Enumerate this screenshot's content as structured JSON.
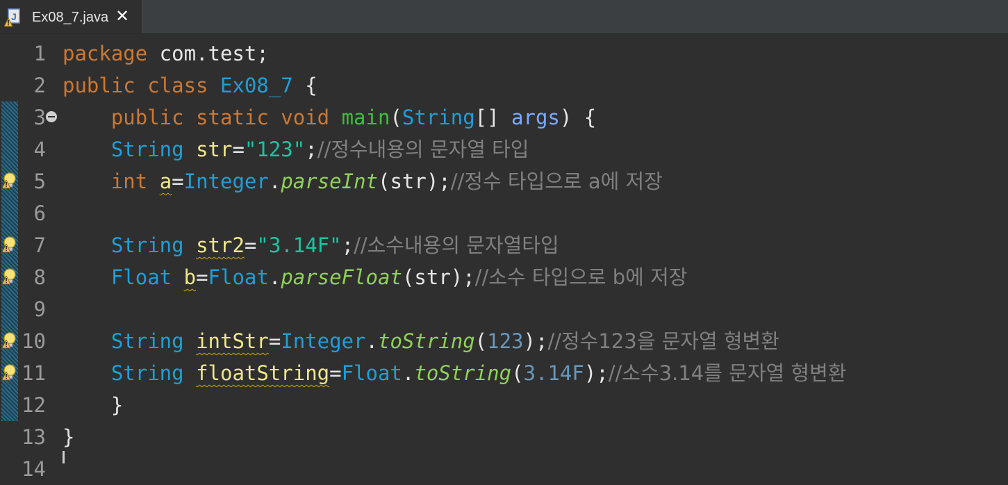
{
  "tab": {
    "title": "Ex08_7.java",
    "close_glyph": "✕",
    "icon": "java-file-warning-icon"
  },
  "lines": [
    {
      "num": "1",
      "parts": [
        [
          "package",
          "kw"
        ],
        [
          " com.test;",
          "plain"
        ]
      ]
    },
    {
      "num": "2",
      "parts": [
        [
          "public class ",
          "kw"
        ],
        [
          "Ex08_7",
          "ty"
        ],
        [
          " {",
          "plain"
        ]
      ]
    },
    {
      "num": "3",
      "fold": true,
      "marker": true,
      "parts": [
        [
          "    public static void ",
          "kw"
        ],
        [
          "main",
          "fn"
        ],
        [
          "(",
          "plain"
        ],
        [
          "String",
          "ty"
        ],
        [
          "[] ",
          "plain"
        ],
        [
          "args",
          "prm"
        ],
        [
          ") {",
          "plain"
        ]
      ]
    },
    {
      "num": "4",
      "marker": true,
      "parts": [
        [
          "    ",
          "plain"
        ],
        [
          "String ",
          "ty"
        ],
        [
          "str",
          "vnorm"
        ],
        [
          "=",
          "plain"
        ],
        [
          "\"123\"",
          "st"
        ],
        [
          ";",
          "plain"
        ],
        [
          "//정수내용의 문자열 타입",
          "cm"
        ]
      ]
    },
    {
      "num": "5",
      "marker": true,
      "warn": true,
      "parts": [
        [
          "    ",
          "plain"
        ],
        [
          "int ",
          "kw"
        ],
        [
          "a",
          "var"
        ],
        [
          "=",
          "plain"
        ],
        [
          "Integer",
          "ty"
        ],
        [
          ".",
          "plain"
        ],
        [
          "parseInt",
          "it"
        ],
        [
          "(str);",
          "plain"
        ],
        [
          "//정수 타입으로 a에 저장",
          "cm"
        ]
      ]
    },
    {
      "num": "6",
      "marker": true,
      "parts": []
    },
    {
      "num": "7",
      "marker": true,
      "warn": true,
      "parts": [
        [
          "    ",
          "plain"
        ],
        [
          "String ",
          "ty"
        ],
        [
          "str2",
          "var"
        ],
        [
          "=",
          "plain"
        ],
        [
          "\"3.14F\"",
          "st"
        ],
        [
          ";",
          "plain"
        ],
        [
          "//소수내용의 문자열타입",
          "cm"
        ]
      ]
    },
    {
      "num": "8",
      "marker": true,
      "warn": true,
      "parts": [
        [
          "    ",
          "plain"
        ],
        [
          "Float ",
          "ty"
        ],
        [
          "b",
          "var"
        ],
        [
          "=",
          "plain"
        ],
        [
          "Float",
          "ty"
        ],
        [
          ".",
          "plain"
        ],
        [
          "parseFloat",
          "it"
        ],
        [
          "(str);",
          "plain"
        ],
        [
          "//소수 타입으로 b에 저장",
          "cm"
        ]
      ]
    },
    {
      "num": "9",
      "marker": true,
      "parts": []
    },
    {
      "num": "10",
      "marker": true,
      "warn": true,
      "parts": [
        [
          "    ",
          "plain"
        ],
        [
          "String ",
          "ty"
        ],
        [
          "intStr",
          "var"
        ],
        [
          "=",
          "plain"
        ],
        [
          "Integer",
          "ty"
        ],
        [
          ".",
          "plain"
        ],
        [
          "toString",
          "it"
        ],
        [
          "(",
          "plain"
        ],
        [
          "123",
          "num"
        ],
        [
          ");",
          "plain"
        ],
        [
          "//정수123을 문자열 형변환",
          "cm"
        ]
      ]
    },
    {
      "num": "11",
      "marker": true,
      "warn": true,
      "parts": [
        [
          "    ",
          "plain"
        ],
        [
          "String ",
          "ty"
        ],
        [
          "floatString",
          "var"
        ],
        [
          "=",
          "plain"
        ],
        [
          "Float",
          "ty"
        ],
        [
          ".",
          "plain"
        ],
        [
          "toString",
          "it"
        ],
        [
          "(",
          "plain"
        ],
        [
          "3.14F",
          "num"
        ],
        [
          ");",
          "plain"
        ],
        [
          "//소수3.14를 문자열 형변환",
          "cm"
        ]
      ]
    },
    {
      "num": "12",
      "marker": true,
      "parts": [
        [
          "    }",
          "plain"
        ]
      ]
    },
    {
      "num": "13",
      "parts": [
        [
          "}",
          "plain"
        ]
      ]
    },
    {
      "num": "14",
      "parts": []
    }
  ]
}
